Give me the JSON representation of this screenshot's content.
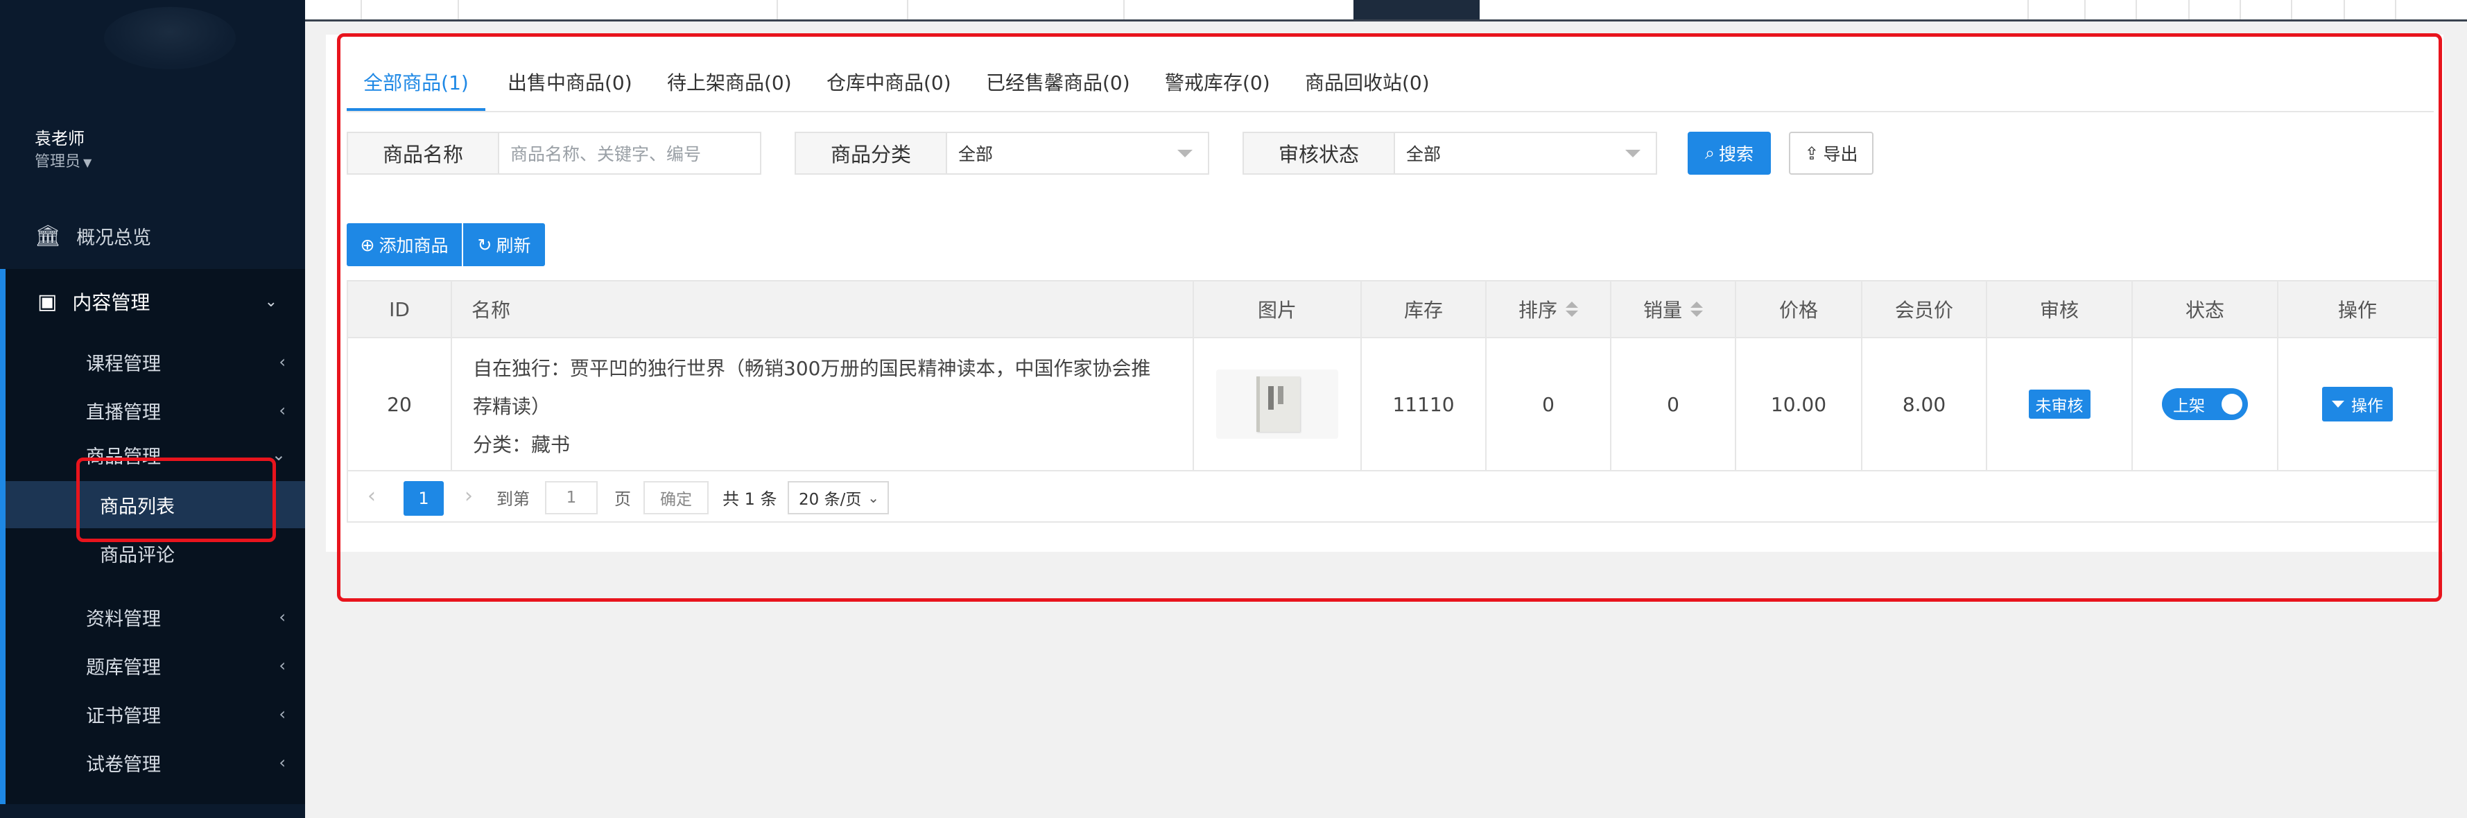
{
  "sidebar": {
    "user_name": "袁老师",
    "user_role": "管理员",
    "overview_label": "概况总览",
    "group_label": "内容管理",
    "items": [
      {
        "label": "课程管理"
      },
      {
        "label": "直播管理"
      },
      {
        "label": "商品管理"
      }
    ],
    "sub_items": [
      {
        "label": "商品列表"
      },
      {
        "label": "商品评论"
      }
    ],
    "more_items": [
      {
        "label": "资料管理"
      },
      {
        "label": "题库管理"
      },
      {
        "label": "证书管理"
      },
      {
        "label": "试卷管理"
      }
    ]
  },
  "tabs": [
    {
      "label": "全部商品(1)"
    },
    {
      "label": "出售中商品(0)"
    },
    {
      "label": "待上架商品(0)"
    },
    {
      "label": "仓库中商品(0)"
    },
    {
      "label": "已经售馨商品(0)"
    },
    {
      "label": "警戒库存(0)"
    },
    {
      "label": "商品回收站(0)"
    }
  ],
  "filters": {
    "name_label": "商品名称",
    "name_placeholder": "商品名称、关键字、编号",
    "category_label": "商品分类",
    "category_value": "全部",
    "review_label": "审核状态",
    "review_value": "全部",
    "search_label": "搜索",
    "export_label": "导出"
  },
  "actions": {
    "add_label": "添加商品",
    "refresh_label": "刷新"
  },
  "table": {
    "columns": [
      "ID",
      "名称",
      "图片",
      "库存",
      "排序",
      "销量",
      "价格",
      "会员价",
      "审核",
      "状态",
      "操作"
    ],
    "rows": [
      {
        "id": "20",
        "name": "自在独行：贾平凹的独行世界（畅销300万册的国民精神读本，中国作家协会推荐精读）",
        "category": "分类：藏书",
        "stock": "11110",
        "sort": "0",
        "sales": "0",
        "price": "10.00",
        "member_price": "8.00",
        "review": "未审核",
        "status": "上架",
        "op": "操作"
      }
    ]
  },
  "pagination": {
    "current": "1",
    "goto_label": "到第",
    "goto_value": "1",
    "page_unit": "页",
    "confirm_label": "确定",
    "total": "共 1 条",
    "page_size": "20 条/页"
  },
  "colors": {
    "accent": "#1e88e5",
    "sidebar_bg": "#0b1a2d",
    "highlight": "#e8141d"
  }
}
